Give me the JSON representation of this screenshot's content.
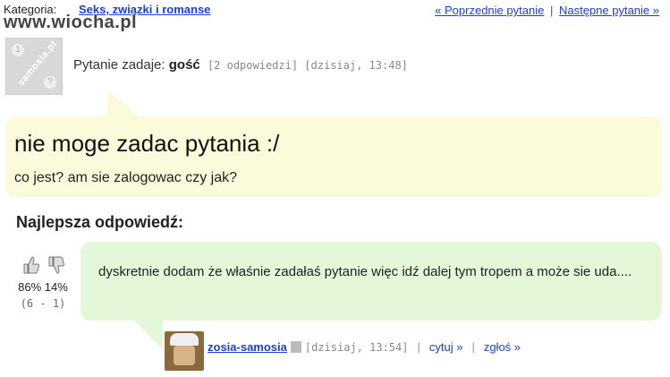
{
  "header": {
    "category_label": "Kategoria:",
    "category_link": "Seks, związki i romanse",
    "watermark": "www.wiocha.pl",
    "nav_prev": "« Poprzednie pytanie",
    "nav_sep": "|",
    "nav_next": "Następne pytanie »"
  },
  "question": {
    "avatar_text": "samosia.pl",
    "asker_prefix": "Pytanie zadaje:",
    "asker_name": "gość",
    "meta": "[2 odpowiedzi] [dzisiaj, 13:48]",
    "title": "nie moge zadac pytania :/",
    "body": "co jest? am sie zalogowac czy jak?"
  },
  "best_answer": {
    "heading": "Najlepsza odpowiedź:",
    "votes": {
      "pct": "86% 14%",
      "counts": "(6 - 1)"
    },
    "text": "dyskretnie dodam że właśnie zadałaś pytanie więc idź dalej tym tropem a może sie uda....",
    "author": "zosia-samosia",
    "time": "[dzisiaj, 13:54]",
    "quote_label": "cytuj »",
    "report_label": "zgłoś »"
  },
  "colors": {
    "link": "#1a3fd6",
    "question_bubble": "#fbfbdc",
    "answer_bubble": "#e4f7d8"
  },
  "icons": [
    "thumbs-up-icon",
    "thumbs-down-icon",
    "user-badge-icon"
  ]
}
